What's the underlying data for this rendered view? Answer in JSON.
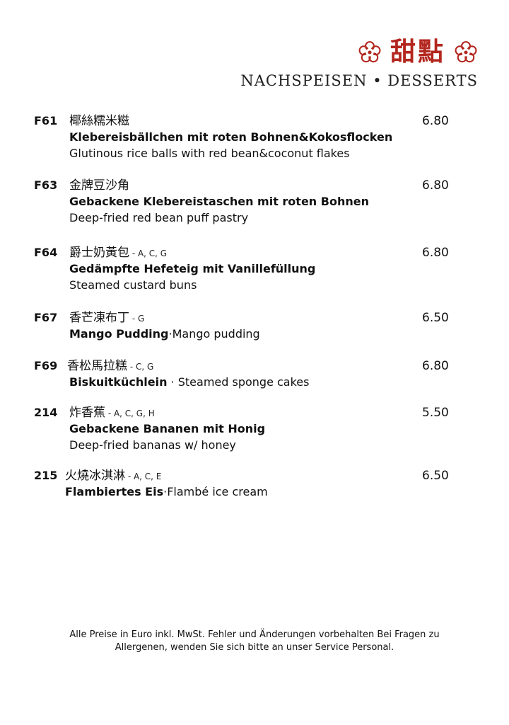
{
  "header": {
    "title_zh": "甜點",
    "subtitle": "NACHSPEISEN • DESSERTS",
    "accent_color": "#b3261e",
    "icon": "plum-blossom-icon"
  },
  "items": [
    {
      "code": "F61",
      "name_zh": "椰絲糯米糍",
      "allergens": "",
      "price": "6.80",
      "name_de": "Klebereisbällchen mit roten Bohnen&Kokosflocken",
      "name_en": "Glutinous rice balls with red bean&coconut flakes"
    },
    {
      "code": "F63",
      "name_zh": "金牌豆沙角",
      "allergens": "",
      "price": "6.80",
      "name_de": "Gebackene Klebereistaschen mit roten Bohnen",
      "name_en": "Deep-fried red bean puff pastry"
    },
    {
      "code": "F64",
      "name_zh": "爵士奶黃包",
      "allergens": " - A, C, G",
      "price": "6.80",
      "name_de": "Gedämpfte Hefeteig mit Vanillefüllung",
      "name_en": "Steamed custard buns"
    },
    {
      "code": "F67",
      "name_zh": "香芒凍布丁",
      "allergens": " - G",
      "price": "6.50",
      "name_de": "Mango Pudding",
      "separator": "·",
      "name_en": "Mango pudding"
    },
    {
      "code": "F69",
      "name_zh": "香松馬拉糕",
      "allergens": " - C, G",
      "price": "6.80",
      "name_de": "Biskuitküchlein",
      "separator": " · ",
      "name_en": "Steamed sponge cakes"
    },
    {
      "code": "214",
      "name_zh": "炸香蕉",
      "allergens": " - A, C, G, H",
      "price": "5.50",
      "name_de": "Gebackene Bananen mit Honig",
      "name_en": "Deep-fried bananas w/ honey"
    },
    {
      "code": "215",
      "name_zh": "火燒冰淇淋",
      "allergens": " - A, C, E",
      "price": "6.50",
      "name_de": "Flambiertes Eis",
      "separator": "·",
      "name_en": "Flambé ice cream"
    }
  ],
  "footer": {
    "line1": "Alle Preise in Euro inkl. MwSt. Fehler und Änderungen vorbehalten Bei Fragen zu",
    "line2": "Allergenen, wenden Sie sich bitte an unser Service Personal."
  }
}
